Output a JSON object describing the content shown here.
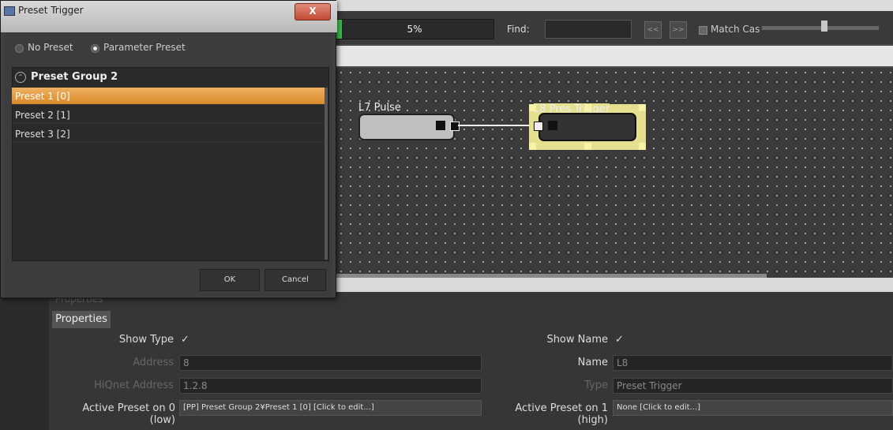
{
  "toolbar": {
    "progress_text": "5%",
    "progress_fraction": 0.04,
    "find_label": "Find:",
    "find_value": "",
    "prev_icon": "<<",
    "next_icon": ">>",
    "match_case_label": "Match Cas"
  },
  "canvas": {
    "blocks": [
      {
        "label": "L7 Pulse"
      },
      {
        "label": "L8 Pres Trigger"
      }
    ]
  },
  "properties": {
    "ghost_title": "Properties",
    "tab_label": "Properties",
    "show_type_label": "Show Type",
    "show_type_check": "✓",
    "show_name_label": "Show Name",
    "show_name_check": "✓",
    "address_label": "Address",
    "address_value": "8",
    "name_label": "Name",
    "name_value": "L8",
    "hiqnet_label": "HiQnet Address",
    "hiqnet_value": "1.2.8",
    "type_label": "Type",
    "type_value": "Preset Trigger",
    "active_low_label": "Active Preset on 0 (low)",
    "active_low_value": "[PP] Preset Group 2¥Preset 1 [0] [Click to edit...]",
    "active_high_label": "Active Preset on 1 (high)",
    "active_high_value": "None [Click to edit...]"
  },
  "dialog": {
    "title": "Preset Trigger",
    "close_label": "X",
    "radio_no_preset": "No Preset",
    "radio_param_preset": "Parameter Preset",
    "group_label": "Preset Group 2",
    "items": [
      "Preset 1 [0]",
      "Preset 2 [1]",
      "Preset 3 [2]"
    ],
    "ok_label": "OK",
    "cancel_label": "Cancel"
  },
  "colors": {
    "selection_orange": "#e69a3c",
    "block_highlight": "#e4e090",
    "progress_green": "#3cc24a"
  }
}
